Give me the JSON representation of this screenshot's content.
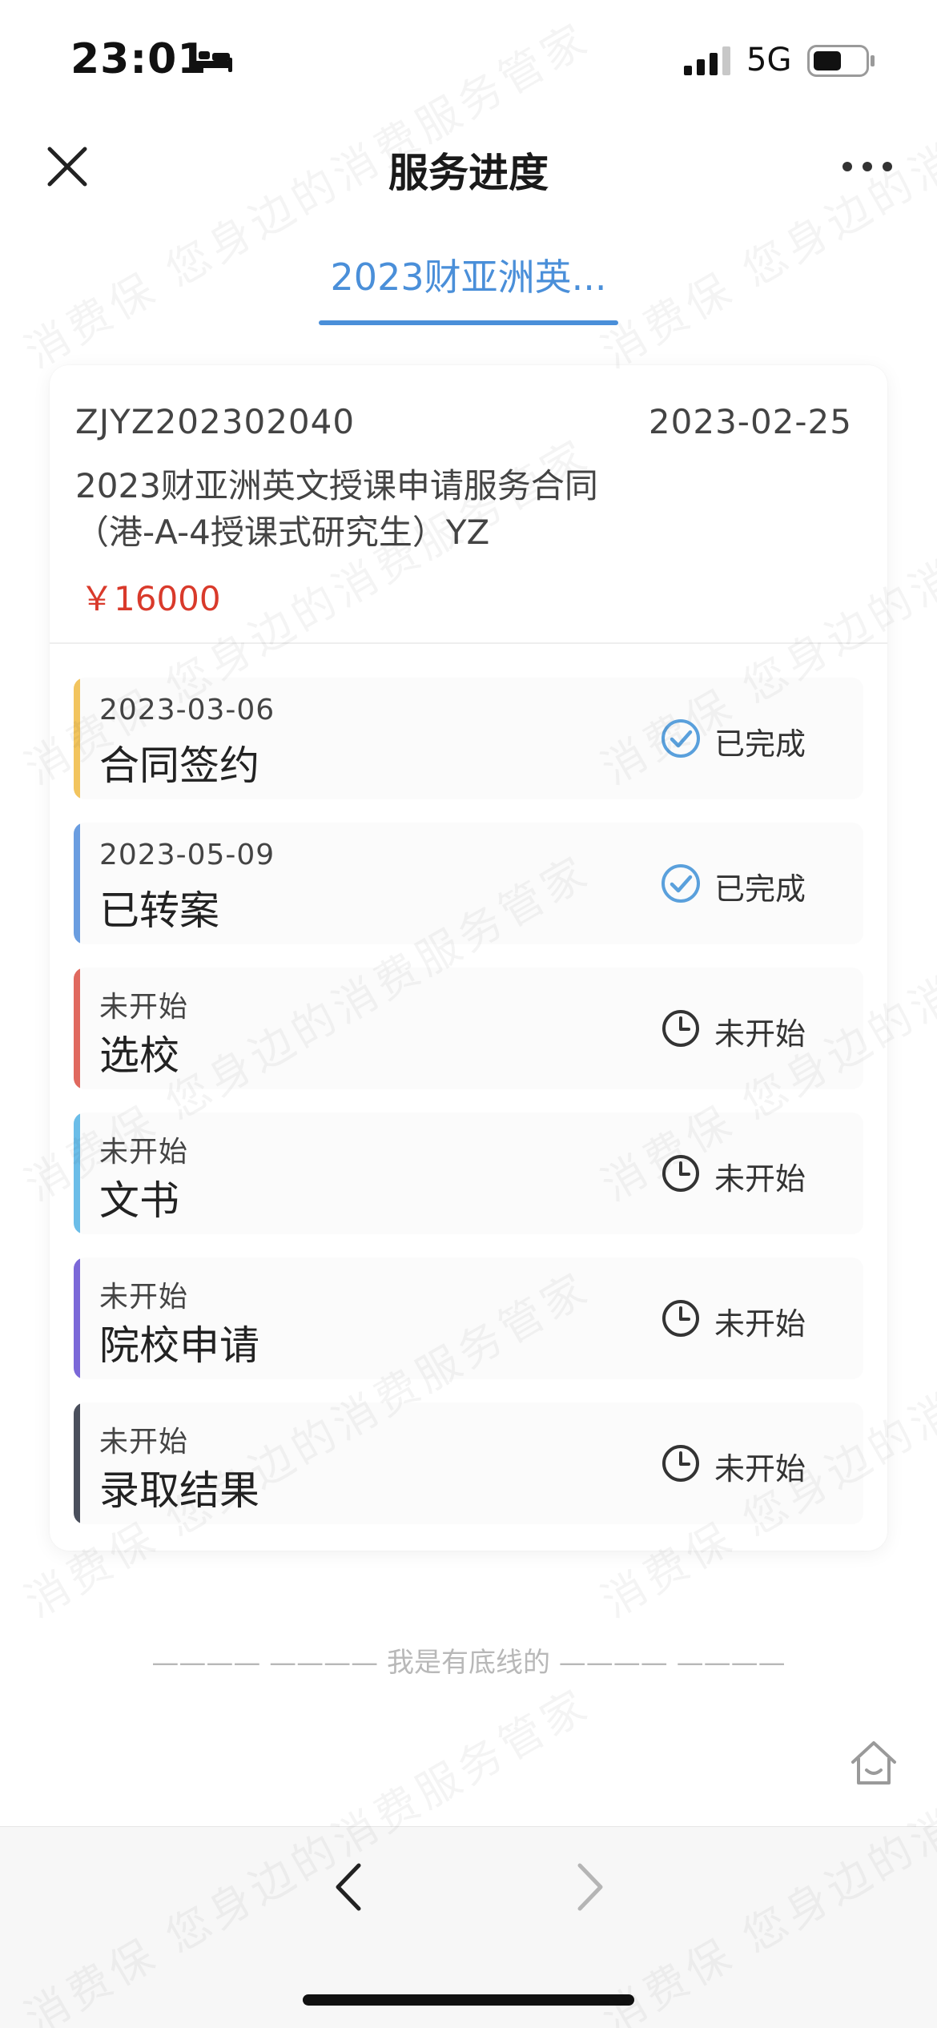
{
  "status_bar": {
    "time": "23:01",
    "network": "5G"
  },
  "nav": {
    "title": "服务进度"
  },
  "tabs": [
    {
      "label": "2023财亚洲英..."
    }
  ],
  "contract": {
    "number": "ZJYZ202302040",
    "date": "2023-02-25",
    "name": "2023财亚洲英文授课申请服务合同（港-A-4授课式研究生）YZ",
    "price": "￥16000"
  },
  "steps": [
    {
      "date": "2023-03-06",
      "name": "合同签约",
      "status": "已完成",
      "status_icon": "check-circle-icon",
      "color": "#f2c45e"
    },
    {
      "date": "2023-05-09",
      "name": "已转案",
      "status": "已完成",
      "status_icon": "check-circle-icon",
      "color": "#6a9de0"
    },
    {
      "date": "未开始",
      "name": "选校",
      "status": "未开始",
      "status_icon": "clock-icon",
      "color": "#e0695f"
    },
    {
      "date": "未开始",
      "name": "文书",
      "status": "未开始",
      "status_icon": "clock-icon",
      "color": "#6bbde8"
    },
    {
      "date": "未开始",
      "name": "院校申请",
      "status": "未开始",
      "status_icon": "clock-icon",
      "color": "#7b68d8"
    },
    {
      "date": "未开始",
      "name": "录取结果",
      "status": "未开始",
      "status_icon": "clock-icon",
      "color": "#4a4f5c"
    }
  ],
  "footer": {
    "bottom_line": "———— ———— 我是有底线的 ———— ————"
  },
  "watermark": {
    "text": "消费保 您身边的消费服务管家"
  },
  "colors": {
    "accent": "#4a8fd9",
    "price": "#d93a2b",
    "check": "#5aa0dc"
  }
}
